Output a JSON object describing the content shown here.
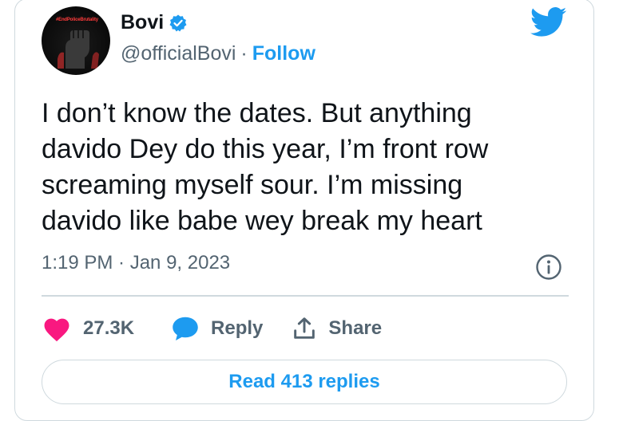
{
  "author": {
    "name": "Bovi",
    "handle": "@officialBovi",
    "separator": "·",
    "follow_label": "Follow",
    "verified": true,
    "avatar_tag": "#EndPoliceBrutality"
  },
  "tweet": {
    "text": "I don’t know the dates. But anything\ndavido Dey do this year, I’m front row\nscreaming myself sour. I’m missing\ndavido like babe wey break my heart",
    "timestamp": "1:19 PM · Jan 9, 2023"
  },
  "actions": {
    "likes": "27.3K",
    "reply_label": "Reply",
    "share_label": "Share"
  },
  "read_replies_label": "Read 413 replies",
  "colors": {
    "accent": "#1d9bf0",
    "like": "#f91880",
    "secondary_text": "#536471",
    "border": "#cfd9de"
  },
  "icons": [
    "verified-badge-icon",
    "twitter-bird-icon",
    "info-icon",
    "heart-icon",
    "reply-bubble-icon",
    "share-icon"
  ]
}
